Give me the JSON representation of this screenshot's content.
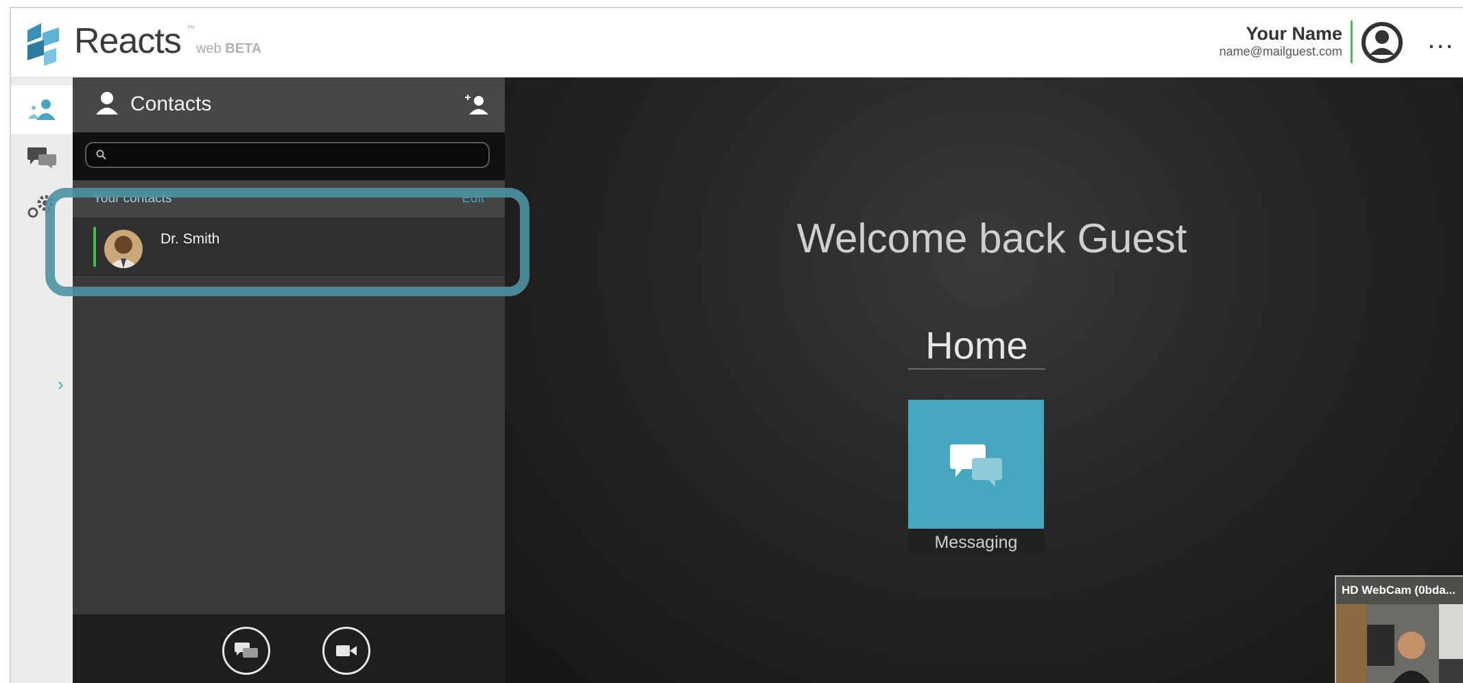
{
  "header": {
    "brand": "Reacts",
    "brand_tm": "™",
    "brand_sub": "web",
    "brand_beta": "BETA",
    "user_name": "Your Name",
    "user_email": "name@mailguest.com",
    "more_label": "...",
    "accent_color": "#3fbf4f"
  },
  "rail": {
    "items": [
      {
        "icon": "contacts-icon",
        "active": true
      },
      {
        "icon": "chat-bubbles-icon",
        "active": false
      },
      {
        "icon": "settings-gears-icon",
        "active": false
      }
    ],
    "expand_label": "›"
  },
  "contacts_panel": {
    "title": "Contacts",
    "search_placeholder": "",
    "section_label": "Your contacts",
    "edit_label": "Edit",
    "contacts": [
      {
        "name": "Dr. Smith",
        "status_color": "#3fbf4f"
      }
    ]
  },
  "main": {
    "welcome": "Welcome back Guest",
    "home_title": "Home",
    "tile_label": "Messaging",
    "tile_color": "#45a6bd"
  },
  "webcam": {
    "label": "HD WebCam (0bda..."
  }
}
